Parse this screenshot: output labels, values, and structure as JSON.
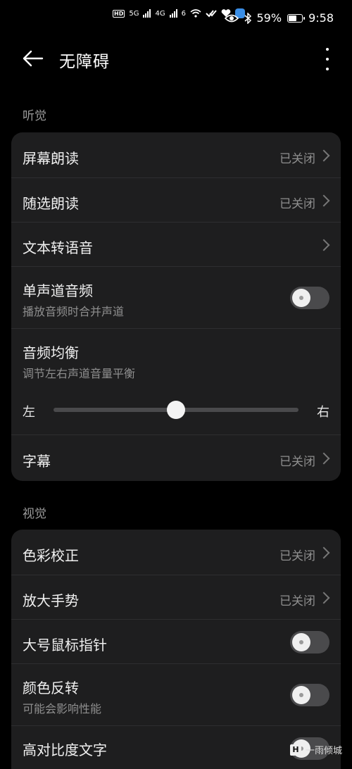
{
  "status_bar": {
    "network_1": "5G",
    "network_2": "4G",
    "network_3": "6",
    "battery_percent": "59%",
    "time": "9:58",
    "icons": [
      "hd-icon",
      "signal-icon",
      "wifi-icon",
      "check-icon",
      "heart-icon",
      "app-icon",
      "eye-icon",
      "bluetooth-icon",
      "battery-icon"
    ]
  },
  "header": {
    "title": "无障碍"
  },
  "hearing": {
    "label": "听觉",
    "items": {
      "screen_reader": {
        "title": "屏幕朗读",
        "value": "已关闭"
      },
      "select_to_speak": {
        "title": "随选朗读",
        "value": "已关闭"
      },
      "tts": {
        "title": "文本转语音"
      },
      "mono_audio": {
        "title": "单声道音频",
        "subtitle": "播放音频时合并声道",
        "enabled": false
      },
      "audio_balance": {
        "title": "音频均衡",
        "subtitle": "调节左右声道音量平衡",
        "left": "左",
        "right": "右",
        "value": 0.5
      },
      "captions": {
        "title": "字幕",
        "value": "已关闭"
      }
    }
  },
  "vision": {
    "label": "视觉",
    "items": {
      "color_correction": {
        "title": "色彩校正",
        "value": "已关闭"
      },
      "magnification": {
        "title": "放大手势",
        "value": "已关闭"
      },
      "large_pointer": {
        "title": "大号鼠标指针",
        "enabled": false
      },
      "color_inversion": {
        "title": "颜色反转",
        "subtitle": "可能会影响性能",
        "enabled": false
      },
      "high_contrast": {
        "title": "高对比度文字",
        "enabled": false
      }
    }
  },
  "watermark": {
    "text": "一雨倾城",
    "logo": "H"
  }
}
